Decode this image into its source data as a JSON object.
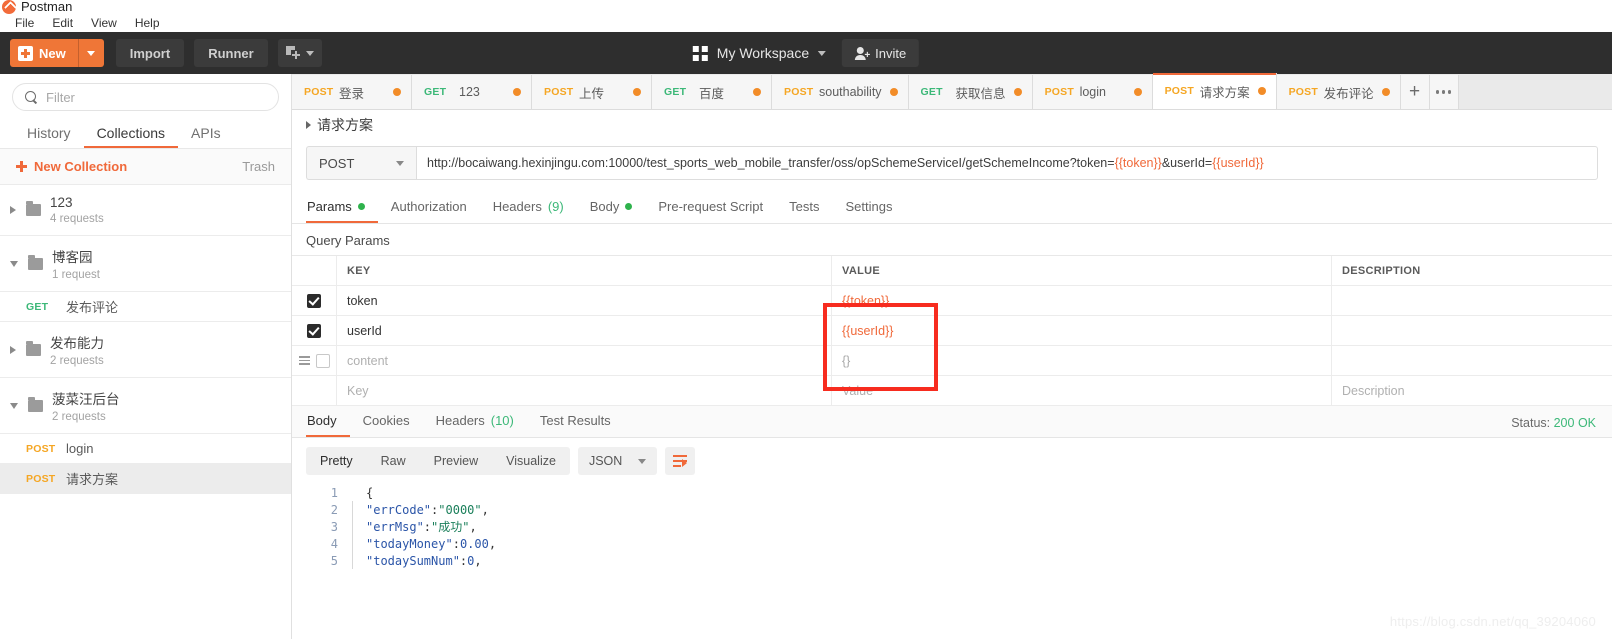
{
  "window": {
    "app_title": "Postman"
  },
  "menubar": {
    "items": [
      "File",
      "Edit",
      "View",
      "Help"
    ]
  },
  "toolbar": {
    "new_label": "New",
    "import_label": "Import",
    "runner_label": "Runner",
    "workspace_label": "My Workspace",
    "invite_label": "Invite"
  },
  "sidebar": {
    "filter_placeholder": "Filter",
    "tabs": [
      {
        "label": "History",
        "active": false
      },
      {
        "label": "Collections",
        "active": true
      },
      {
        "label": "APIs",
        "active": false
      }
    ],
    "new_collection_label": "New Collection",
    "trash_label": "Trash",
    "items": [
      {
        "type": "collection",
        "name": "123",
        "sub": "4 requests",
        "expanded": false
      },
      {
        "type": "collection",
        "name": "博客园",
        "sub": "1 request",
        "expanded": true
      },
      {
        "type": "request",
        "method": "GET",
        "name": "发布评论",
        "selected": false
      },
      {
        "type": "collection",
        "name": "发布能力",
        "sub": "2 requests",
        "expanded": false
      },
      {
        "type": "collection",
        "name": "菠菜汪后台",
        "sub": "2 requests",
        "expanded": true
      },
      {
        "type": "request",
        "method": "POST",
        "name": "login",
        "selected": false
      },
      {
        "type": "request",
        "method": "POST",
        "name": "请求方案",
        "selected": true
      }
    ]
  },
  "request_tabs": [
    {
      "method": "POST",
      "name": "登录",
      "dirty": true,
      "active": false
    },
    {
      "method": "GET",
      "name": "123",
      "dirty": true,
      "active": false
    },
    {
      "method": "POST",
      "name": "上传",
      "dirty": true,
      "active": false
    },
    {
      "method": "GET",
      "name": "百度",
      "dirty": true,
      "active": false
    },
    {
      "method": "POST",
      "name": "southability",
      "dirty": true,
      "active": false
    },
    {
      "method": "GET",
      "name": "获取信息",
      "dirty": true,
      "active": false
    },
    {
      "method": "POST",
      "name": "login",
      "dirty": true,
      "active": false
    },
    {
      "method": "POST",
      "name": "请求方案",
      "dirty": true,
      "active": true
    },
    {
      "method": "POST",
      "name": "发布评论",
      "dirty": true,
      "active": false
    }
  ],
  "tabbar_actions": {
    "new_tab": "+",
    "more": "•••"
  },
  "request": {
    "title": "请求方案",
    "method": "POST",
    "url_prefix": "http://bocaiwang.hexinjingu.com:10000/test_sports_web_mobile_transfer/oss/opSchemeServiceI/getSchemeIncome?token=",
    "url_var1": "{{token}}",
    "url_mid": "&userId=",
    "url_var2": "{{userId}}",
    "tabs": [
      {
        "label": "Params",
        "active": true,
        "dot": true
      },
      {
        "label": "Authorization",
        "active": false,
        "dot": false
      },
      {
        "label": "Headers",
        "active": false,
        "count": "(9)"
      },
      {
        "label": "Body",
        "active": false,
        "dot": true
      },
      {
        "label": "Pre-request Script",
        "active": false
      },
      {
        "label": "Tests",
        "active": false
      },
      {
        "label": "Settings",
        "active": false
      }
    ],
    "query_params_label": "Query Params",
    "table": {
      "headers": {
        "key": "KEY",
        "value": "VALUE",
        "description": "DESCRIPTION"
      },
      "rows": [
        {
          "checked": true,
          "key": "token",
          "value": "{{token}}",
          "description": "",
          "value_is_var": true
        },
        {
          "checked": true,
          "key": "userId",
          "value": "{{userId}}",
          "description": "",
          "value_is_var": true
        },
        {
          "checked": false,
          "key": "content",
          "value": "{}",
          "description": "",
          "placeholder": true
        },
        {
          "checked": null,
          "key": "Key",
          "value": "Value",
          "description": "Description",
          "placeholder": true
        }
      ]
    }
  },
  "response": {
    "tabs": [
      {
        "label": "Body",
        "active": true
      },
      {
        "label": "Cookies",
        "active": false
      },
      {
        "label": "Headers",
        "active": false,
        "count": "(10)"
      },
      {
        "label": "Test Results",
        "active": false
      }
    ],
    "status_label": "Status:",
    "status_value": "200 OK",
    "formats": [
      {
        "label": "Pretty",
        "active": true
      },
      {
        "label": "Raw",
        "active": false
      },
      {
        "label": "Preview",
        "active": false
      },
      {
        "label": "Visualize",
        "active": false
      }
    ],
    "language": "JSON",
    "body_lines": [
      {
        "n": "1",
        "tokens": [
          {
            "t": "punc",
            "v": "{"
          }
        ]
      },
      {
        "n": "2",
        "tokens": [
          {
            "t": "key",
            "v": "    \"errCode\""
          },
          {
            "t": "punc",
            "v": ": "
          },
          {
            "t": "str",
            "v": "\"0000\""
          },
          {
            "t": "punc",
            "v": ","
          }
        ]
      },
      {
        "n": "3",
        "tokens": [
          {
            "t": "key",
            "v": "    \"errMsg\""
          },
          {
            "t": "punc",
            "v": ": "
          },
          {
            "t": "str",
            "v": "\"成功\""
          },
          {
            "t": "punc",
            "v": ","
          }
        ]
      },
      {
        "n": "4",
        "tokens": [
          {
            "t": "key",
            "v": "    \"todayMoney\""
          },
          {
            "t": "punc",
            "v": ": "
          },
          {
            "t": "num",
            "v": "0.00"
          },
          {
            "t": "punc",
            "v": ","
          }
        ]
      },
      {
        "n": "5",
        "tokens": [
          {
            "t": "key",
            "v": "    \"todaySumNum\""
          },
          {
            "t": "punc",
            "v": ": "
          },
          {
            "t": "num",
            "v": "0"
          },
          {
            "t": "punc",
            "v": ","
          }
        ]
      }
    ]
  },
  "annotation": {
    "highlight_color": "#f72c1f"
  },
  "watermark": {
    "text": "https://blog.csdn.net/qq_39204060"
  }
}
